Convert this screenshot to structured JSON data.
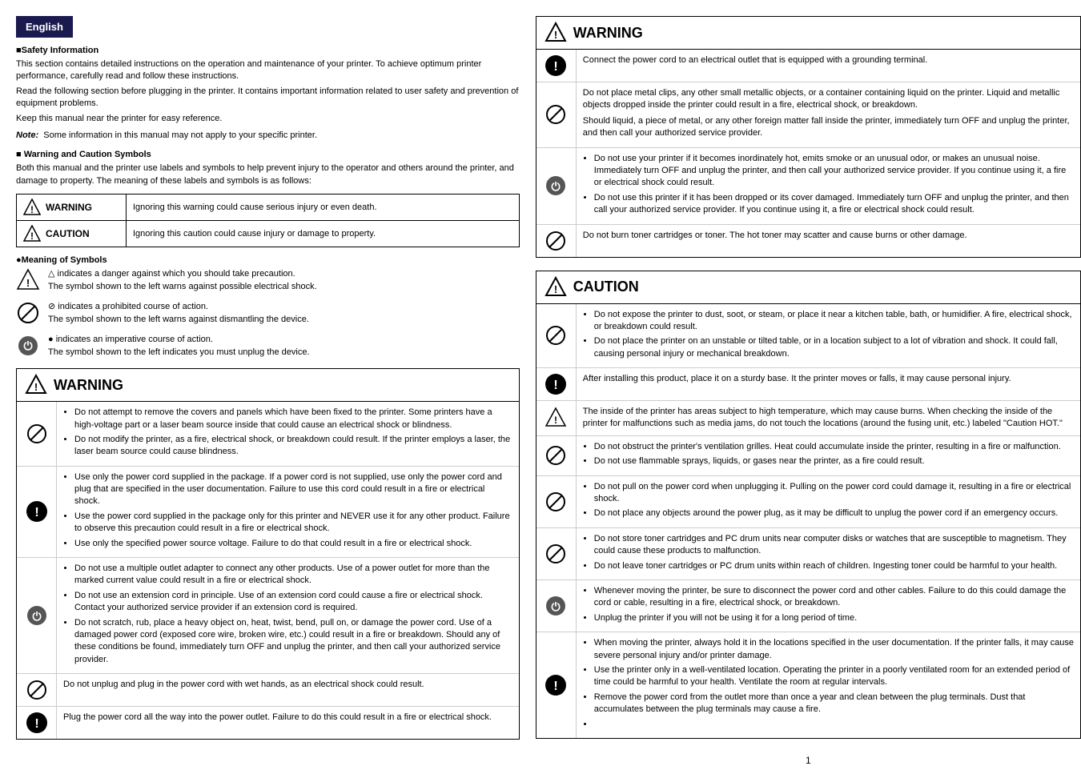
{
  "header": {
    "language": "English"
  },
  "safety_section": {
    "title": "■Safety Information",
    "paragraphs": [
      "This section contains detailed instructions on the operation and maintenance of your printer. To achieve optimum printer performance, carefully read and follow these instructions.",
      "Read the following section before plugging in the printer. It contains important information related to user safety and prevention of equipment problems.",
      "Keep this manual near the printer for easy reference."
    ],
    "note_label": "Note:",
    "note_text": "Some information in this manual may not apply to your specific printer."
  },
  "warning_caution_symbols": {
    "title": "■ Warning and Caution Symbols",
    "intro": "Both this manual and the printer use labels and symbols to help prevent injury to the operator and others around the printer, and damage to property. The meaning of these labels and symbols is as follows:",
    "table": [
      {
        "symbol": "WARNING",
        "description": "Ignoring this warning could cause serious injury or even death."
      },
      {
        "symbol": "CAUTION",
        "description": "Ignoring this caution could cause injury or damage to property."
      }
    ]
  },
  "meaning_of_symbols": {
    "title": "●Meaning of Symbols",
    "items": [
      {
        "icon_type": "triangle",
        "text1": "△ indicates a danger against which you should take precaution.",
        "text2": "The symbol shown to the left warns against possible electrical shock."
      },
      {
        "icon_type": "circle-slash",
        "text1": "⊘ indicates a prohibited course of action.",
        "text2": "The symbol shown to the left warns against dismantling the device."
      },
      {
        "icon_type": "plug",
        "text1": "● indicates an imperative course of action.",
        "text2": "The symbol shown to the left indicates you must unplug the device."
      }
    ]
  },
  "warning_box_left": {
    "title": "WARNING",
    "rows": [
      {
        "icon": "circle-slash",
        "bullets": [
          "Do not attempt to remove the covers and panels which have been fixed to the printer. Some printers have a high-voltage part or a laser beam source inside that could cause an electrical shock or blindness.",
          "Do not modify the printer, as a fire, electrical shock, or breakdown could result. If the printer employs a laser, the laser beam source could cause blindness."
        ]
      },
      {
        "icon": "exclaim-black",
        "bullets": [
          "Use only the power cord supplied in the package. If a power cord is not supplied, use only the power cord and plug that are specified in the user documentation. Failure to use this cord could result in a fire or electrical shock.",
          "Use the power cord supplied in the package only for this printer and NEVER use it for any other product. Failure to observe this precaution could result in a fire or electrical shock.",
          "Use only the specified power source voltage. Failure to do that could result in a fire or electrical shock."
        ]
      },
      {
        "icon": "plug",
        "bullets": [
          "Do not use a multiple outlet adapter to connect any other products. Use of a power outlet for more than the marked current value could result in a fire or electrical shock.",
          "Do not use an extension cord in principle. Use of an extension cord could cause a fire or electrical shock. Contact your authorized service provider if an extension cord is required.",
          "Do not scratch, rub, place a heavy object on, heat, twist, bend, pull on, or damage the power cord. Use of a damaged power cord (exposed core wire, broken wire, etc.) could result in a fire or breakdown. Should any of these conditions be found, immediately turn OFF and unplug the printer, and then call your authorized service provider."
        ]
      },
      {
        "icon": "circle-slash",
        "single": "Do not unplug and plug in the power cord with wet hands, as an electrical shock could result."
      },
      {
        "icon": "exclaim-black",
        "single": "Plug the power cord all the way into the power outlet. Failure to do this could result in a fire or electrical shock."
      }
    ]
  },
  "warning_box_right": {
    "title": "WARNING",
    "rows": [
      {
        "icon": "exclaim-black",
        "single": "Connect the power cord to an electrical outlet that is equipped with a grounding terminal."
      },
      {
        "icon": "circle-slash",
        "paragraphs": [
          "Do not place metal clips, any other small metallic objects, or a container containing liquid on the printer. Liquid and metallic objects dropped inside the printer could result in a fire, electrical shock, or breakdown.",
          "Should liquid, a piece of metal, or any other foreign matter fall inside the printer, immediately turn OFF and unplug the printer, and then call your authorized service provider."
        ]
      },
      {
        "icon": "plug",
        "bullets": [
          "Do not use your printer if it becomes inordinately hot, emits smoke or an unusual odor, or makes an unusual noise. Immediately turn OFF and unplug the printer, and then call your authorized service provider. If you continue using it, a fire or electrical shock could result.",
          "Do not use this printer if it has been dropped or its cover damaged. Immediately turn OFF and unplug the printer, and then call your authorized service provider. If you continue using it, a fire or electrical shock could result."
        ]
      },
      {
        "icon": "circle-slash",
        "single": "Do not burn toner cartridges or toner. The hot toner may scatter and cause burns or other damage."
      }
    ]
  },
  "caution_box": {
    "title": "CAUTION",
    "rows": [
      {
        "icon": "circle-slash",
        "bullets": [
          "Do not expose the printer to dust, soot, or steam, or place it near a kitchen table, bath, or humidifier. A fire, electrical shock, or breakdown could result.",
          "Do not place the printer on an unstable or tilted table, or in a location subject to a lot of vibration and shock. It could fall, causing personal injury or mechanical breakdown."
        ]
      },
      {
        "icon": "exclaim-black",
        "single": "After installing this product, place it on a sturdy base. It the printer moves or falls, it may cause personal injury."
      },
      {
        "icon": "triangle",
        "single": "The inside of the printer has areas subject to high temperature, which may cause burns. When checking the inside of the printer for malfunctions such as media jams, do not touch the locations (around the fusing unit, etc.) labeled \"Caution HOT.\""
      },
      {
        "icon": "circle-slash",
        "bullets": [
          "Do not obstruct the printer's ventilation grilles. Heat could accumulate inside the printer, resulting in a fire or malfunction.",
          "Do not use flammable sprays, liquids, or gases near the printer, as a fire could result."
        ]
      },
      {
        "icon": "circle-slash",
        "bullets": [
          "Do not pull on the power cord when unplugging it. Pulling on the power cord could damage it, resulting in a fire or electrical shock.",
          "Do not place any objects around the power plug, as it may be difficult to unplug the power cord if an emergency occurs."
        ]
      },
      {
        "icon": "circle-slash",
        "bullets": [
          "Do not store toner cartridges and PC drum units near computer disks or watches that are susceptible to magnetism. They could cause these products to malfunction.",
          "Do not leave toner cartridges or PC drum units within reach of children. Ingesting toner could be harmful to your health."
        ]
      },
      {
        "icon": "plug",
        "bullets": [
          "Whenever moving the printer, be sure to disconnect the power cord and other cables. Failure to do this could damage the cord or cable, resulting in a fire, electrical shock, or breakdown.",
          "Unplug the printer if you will not be using it for a long period of time."
        ]
      },
      {
        "icon": "exclaim-black",
        "bullets": [
          "When moving the printer, always hold it in the locations specified in the user documentation. If the printer falls, it may cause severe personal injury and/or printer damage.",
          "Use the printer only in a well-ventilated location. Operating the printer in a poorly ventilated room for an extended period of time could be harmful to your health. Ventilate the room at regular intervals.",
          "Remove the power cord from the outlet more than once a year and clean between the plug terminals. Dust that accumulates between the plug terminals may cause a fire."
        ]
      }
    ]
  },
  "page_number": "1"
}
